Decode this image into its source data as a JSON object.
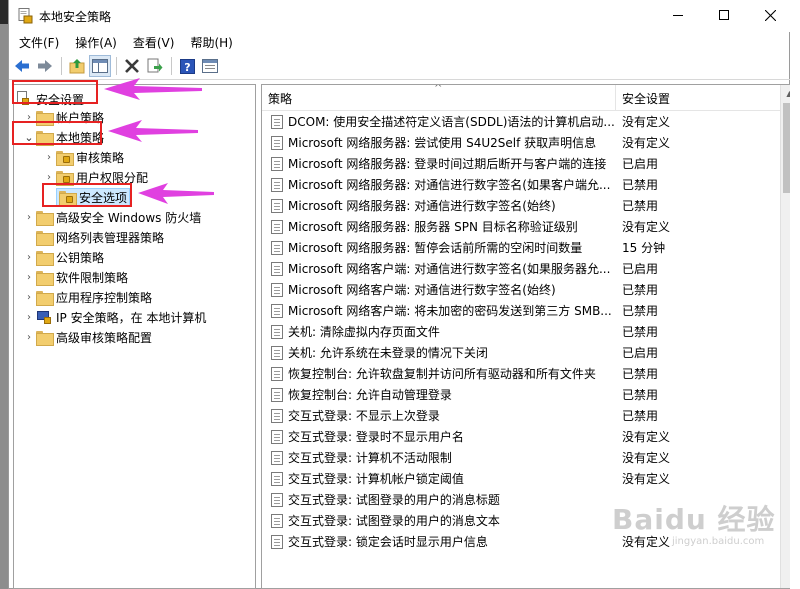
{
  "window": {
    "title": "本地安全策略"
  },
  "menu": [
    {
      "label": "文件(F)"
    },
    {
      "label": "操作(A)"
    },
    {
      "label": "查看(V)"
    },
    {
      "label": "帮助(H)"
    }
  ],
  "toolbar": {
    "buttons": [
      "back-arrow-icon",
      "forward-arrow-icon",
      "up-folder-icon",
      "show-tree-icon",
      "delete-icon",
      "export-list-icon",
      "help-icon",
      "properties-icon"
    ]
  },
  "tree": {
    "root": "安全设置",
    "items": [
      {
        "label": "帐户策略"
      },
      {
        "label": "本地策略"
      },
      {
        "label": "审核策略"
      },
      {
        "label": "用户权限分配"
      },
      {
        "label": "安全选项"
      },
      {
        "label": "高级安全 Windows 防火墙"
      },
      {
        "label": "网络列表管理器策略"
      },
      {
        "label": "公钥策略"
      },
      {
        "label": "软件限制策略"
      },
      {
        "label": "应用程序控制策略"
      },
      {
        "label": "IP 安全策略，在 本地计算机"
      },
      {
        "label": "高级审核策略配置"
      }
    ]
  },
  "list": {
    "columns": {
      "policy": "策略",
      "setting": "安全设置"
    },
    "rows": [
      {
        "policy": "DCOM: 使用安全描述符定义语言(SDDL)语法的计算机启动...",
        "setting": "没有定义"
      },
      {
        "policy": "Microsoft 网络服务器: 尝试使用 S4U2Self 获取声明信息",
        "setting": "没有定义"
      },
      {
        "policy": "Microsoft 网络服务器: 登录时间过期后断开与客户端的连接",
        "setting": "已启用"
      },
      {
        "policy": "Microsoft 网络服务器: 对通信进行数字签名(如果客户端允...",
        "setting": "已禁用"
      },
      {
        "policy": "Microsoft 网络服务器: 对通信进行数字签名(始终)",
        "setting": "已禁用"
      },
      {
        "policy": "Microsoft 网络服务器: 服务器 SPN 目标名称验证级别",
        "setting": "没有定义"
      },
      {
        "policy": "Microsoft 网络服务器: 暂停会话前所需的空闲时间数量",
        "setting": "15 分钟"
      },
      {
        "policy": "Microsoft 网络客户端: 对通信进行数字签名(如果服务器允...",
        "setting": "已启用"
      },
      {
        "policy": "Microsoft 网络客户端: 对通信进行数字签名(始终)",
        "setting": "已禁用"
      },
      {
        "policy": "Microsoft 网络客户端: 将未加密的密码发送到第三方 SMB...",
        "setting": "已禁用"
      },
      {
        "policy": "关机: 清除虚拟内存页面文件",
        "setting": "已禁用"
      },
      {
        "policy": "关机: 允许系统在未登录的情况下关闭",
        "setting": "已启用"
      },
      {
        "policy": "恢复控制台: 允许软盘复制并访问所有驱动器和所有文件夹",
        "setting": "已禁用"
      },
      {
        "policy": "恢复控制台: 允许自动管理登录",
        "setting": "已禁用"
      },
      {
        "policy": "交互式登录: 不显示上次登录",
        "setting": "已禁用"
      },
      {
        "policy": "交互式登录: 登录时不显示用户名",
        "setting": "没有定义"
      },
      {
        "policy": "交互式登录: 计算机不活动限制",
        "setting": "没有定义"
      },
      {
        "policy": "交互式登录: 计算机帐户锁定阈值",
        "setting": "没有定义"
      },
      {
        "policy": "交互式登录: 试图登录的用户的消息标题",
        "setting": ""
      },
      {
        "policy": "交互式登录: 试图登录的用户的消息文本",
        "setting": ""
      },
      {
        "policy": "交互式登录: 锁定会话时显示用户信息",
        "setting": "没有定义"
      }
    ]
  },
  "watermark": {
    "main": "Baidu 经验",
    "sub": "jingyan.baidu.com"
  },
  "colors": {
    "annotation_box": "#e62222",
    "annotation_arrow": "#e040e0",
    "selection": "#cce8ff"
  }
}
